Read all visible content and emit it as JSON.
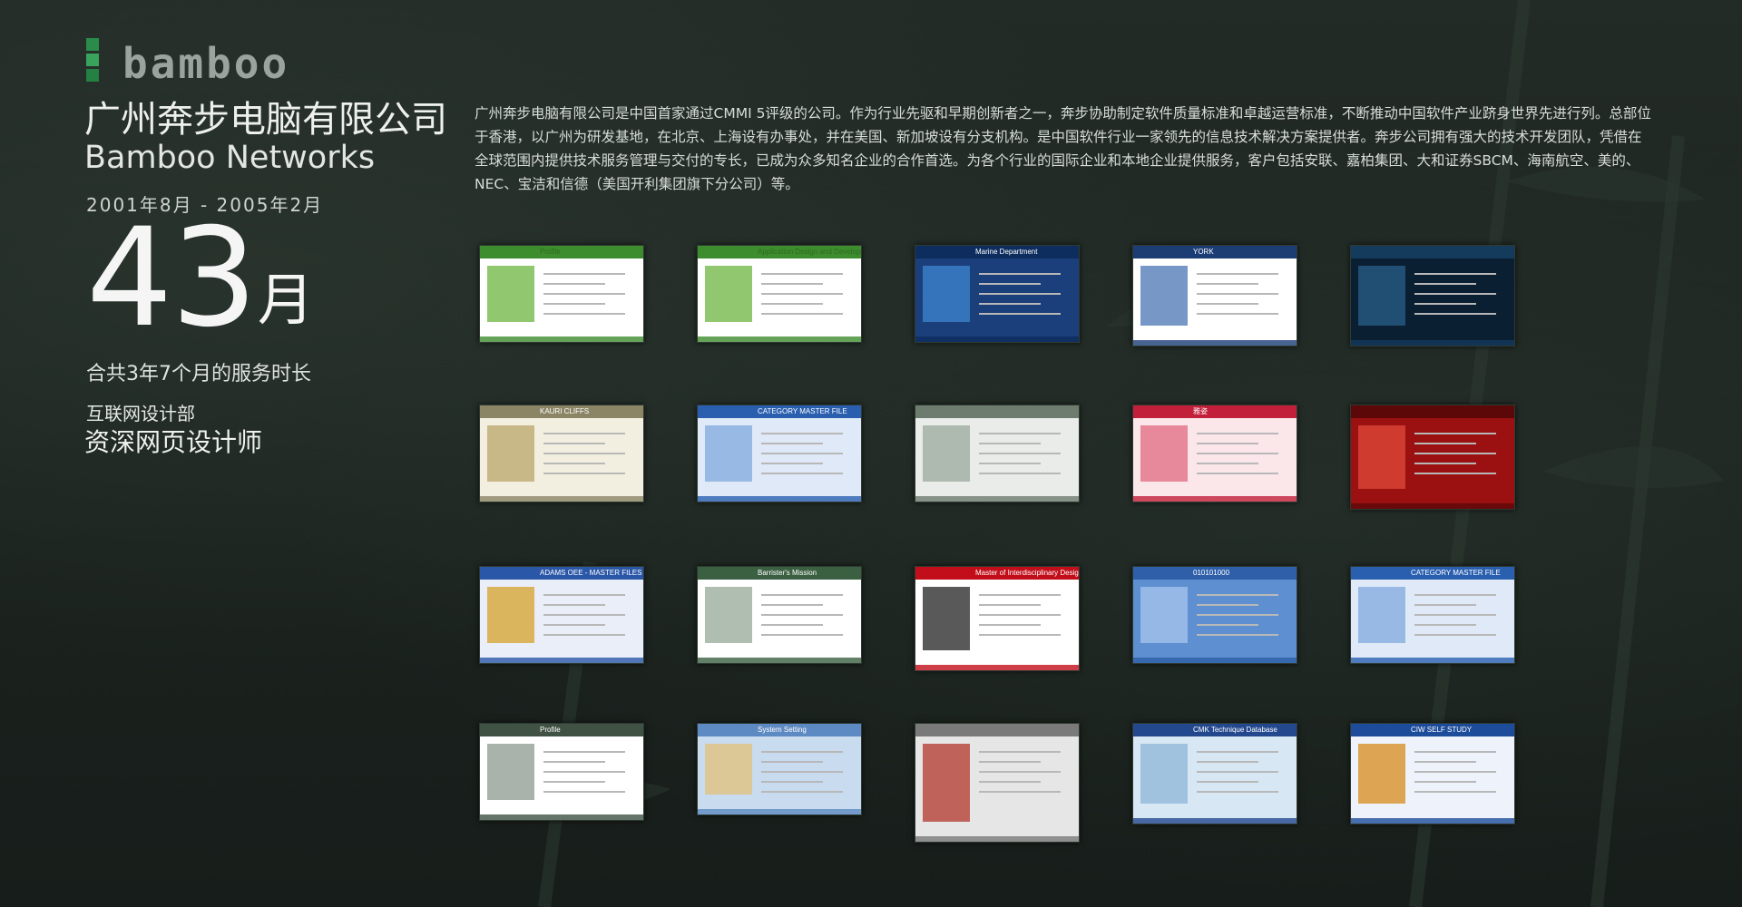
{
  "logo": {
    "wordmark": "bamboo"
  },
  "profile": {
    "company_cn": "广州奔步电脑有限公司",
    "company_en": "Bamboo Networks",
    "period": "2001年8月 - 2005年2月",
    "months_value": "43",
    "months_unit": "月",
    "service_note": "合共3年7个月的服务时长",
    "department": "互联网设计部",
    "role": "资深网页设计师"
  },
  "intro_text": "广州奔步电脑有限公司是中国首家通过CMMI 5评级的公司。作为行业先驱和早期创新者之一，奔步协助制定软件质量标准和卓越运营标准，不断推动中国软件产业跻身世界先进行列。总部位于香港，以广州为研发基地，在北京、上海设有办事处，并在美国、新加坡设有分支机构。是中国软件行业一家领先的信息技术解决方案提供者。奔步公司拥有强大的技术开发团队，凭借在全球范围内提供技术服务管理与交付的专长，已成为众多知名企业的合作首选。为各个行业的国际企业和本地企业提供服务，客户包括安联、嘉柏集团、大和证券SBCM、海南航空、美的、NEC、宝洁和信德（美国开利集团旗下分公司）等。",
  "thumbnails": [
    {
      "theme": "green-profile",
      "caption": "Profile"
    },
    {
      "theme": "green-app",
      "caption": "Application Design and Development"
    },
    {
      "theme": "marine",
      "caption": "Marine Department"
    },
    {
      "theme": "york",
      "caption": "YORK"
    },
    {
      "theme": "dark-gallery",
      "caption": ""
    },
    {
      "theme": "kauri",
      "caption": "KAURI CLIFFS"
    },
    {
      "theme": "category-master",
      "caption": "CATEGORY MASTER FILE"
    },
    {
      "theme": "bank-form",
      "caption": ""
    },
    {
      "theme": "yazi",
      "caption": "雅姿"
    },
    {
      "theme": "red-night",
      "caption": ""
    },
    {
      "theme": "adams",
      "caption": "ADAMS OEE - MASTER FILES"
    },
    {
      "theme": "barrister",
      "caption": "Barrister's Mission"
    },
    {
      "theme": "interdisciplinary",
      "caption": "Master of Interdisciplinary Design & Management"
    },
    {
      "theme": "blue-tech",
      "caption": "010101000"
    },
    {
      "theme": "category-master-2",
      "caption": "CATEGORY MASTER FILE"
    },
    {
      "theme": "grey-profile",
      "caption": "Profile"
    },
    {
      "theme": "system-setting",
      "caption": "System Setting"
    },
    {
      "theme": "hk-institute",
      "caption": ""
    },
    {
      "theme": "pg-cmk",
      "caption": "CMK Technique Database"
    },
    {
      "theme": "ciw",
      "caption": "CIW SELF STUDY"
    }
  ],
  "colors": {
    "accent_green": "#2b8b4b",
    "background": "#1c231f"
  }
}
